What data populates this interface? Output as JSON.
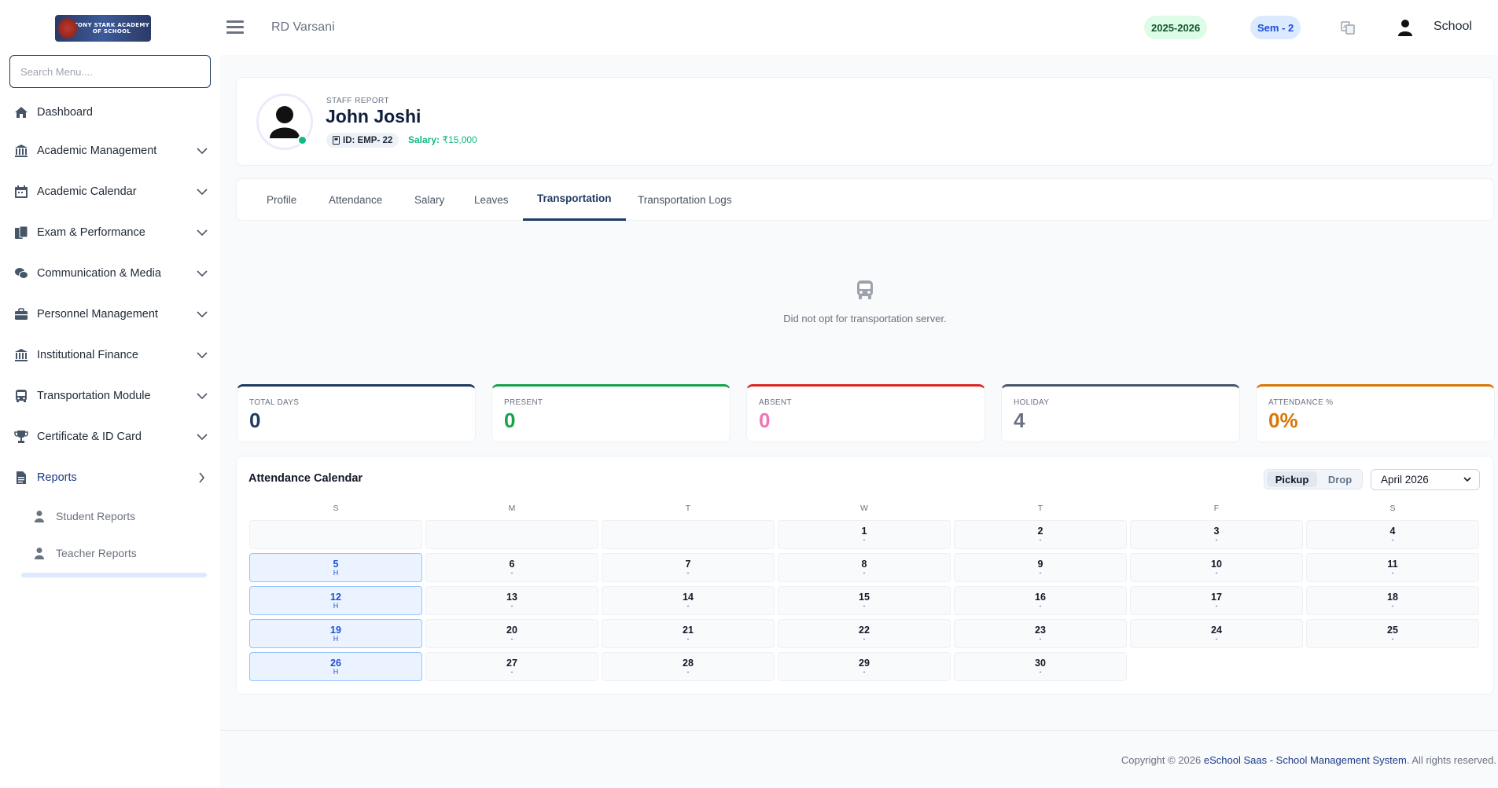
{
  "sidebar": {
    "logo_text": "TONY STARK ACADEMY OF SCHOOL",
    "search_placeholder": "Search Menu....",
    "items": [
      {
        "label": "Dashboard",
        "icon": "home-icon",
        "expandable": false
      },
      {
        "label": "Academic Management",
        "icon": "institution-icon",
        "expandable": true
      },
      {
        "label": "Academic Calendar",
        "icon": "calendar-icon",
        "expandable": true
      },
      {
        "label": "Exam & Performance",
        "icon": "file-copy-icon",
        "expandable": true
      },
      {
        "label": "Communication & Media",
        "icon": "chat-bubbles-icon",
        "expandable": true
      },
      {
        "label": "Personnel Management",
        "icon": "briefcase-icon",
        "expandable": true
      },
      {
        "label": "Institutional Finance",
        "icon": "bank-icon",
        "expandable": true
      },
      {
        "label": "Transportation Module",
        "icon": "bus-icon",
        "expandable": true
      },
      {
        "label": "Certificate & ID Card",
        "icon": "trophy-icon",
        "expandable": true
      },
      {
        "label": "Reports",
        "icon": "report-file-icon",
        "expandable": true,
        "active": true
      }
    ],
    "subitems": [
      {
        "label": "Student Reports",
        "icon": "user-icon"
      },
      {
        "label": "Teacher Reports",
        "icon": "user-icon"
      }
    ]
  },
  "header": {
    "school_name": "RD Varsani",
    "year": "2025-2026",
    "semester": "Sem - 2",
    "user_name": "School"
  },
  "profile": {
    "section_label": "STAFF REPORT",
    "name": "John Joshi",
    "id_text": "ID: EMP- 22",
    "salary_label": "Salary:",
    "salary_value": "₹15,000"
  },
  "tabs": [
    "Profile",
    "Attendance",
    "Salary",
    "Leaves",
    "Transportation",
    "Transportation Logs"
  ],
  "active_tab": "Transportation",
  "empty_state": {
    "message": "Did not opt for transportation server."
  },
  "stats": [
    {
      "label": "TOTAL DAYS",
      "value": "0",
      "color": "#1e3a5f"
    },
    {
      "label": "PRESENT",
      "value": "0",
      "color": "#16a34a"
    },
    {
      "label": "ABSENT",
      "value": "0",
      "color": "#dc2626"
    },
    {
      "label": "HOLIDAY",
      "value": "4",
      "color": "#475569"
    },
    {
      "label": "ATTENDANCE %",
      "value": "0%",
      "color": "#d97706"
    }
  ],
  "calendar": {
    "title": "Attendance Calendar",
    "toggle": {
      "pickup": "Pickup",
      "drop": "Drop",
      "active": "Pickup"
    },
    "month": "April 2026",
    "weekdays": [
      "S",
      "M",
      "T",
      "W",
      "T",
      "F",
      "S"
    ],
    "first_weekday": 3,
    "days": [
      {
        "n": "1",
        "s": "-"
      },
      {
        "n": "2",
        "s": "-"
      },
      {
        "n": "3",
        "s": "-"
      },
      {
        "n": "4",
        "s": "-"
      },
      {
        "n": "5",
        "s": "H",
        "holiday": true
      },
      {
        "n": "6",
        "s": "-"
      },
      {
        "n": "7",
        "s": "-"
      },
      {
        "n": "8",
        "s": "-"
      },
      {
        "n": "9",
        "s": "-"
      },
      {
        "n": "10",
        "s": "-"
      },
      {
        "n": "11",
        "s": "-"
      },
      {
        "n": "12",
        "s": "H",
        "holiday": true
      },
      {
        "n": "13",
        "s": "-"
      },
      {
        "n": "14",
        "s": "-"
      },
      {
        "n": "15",
        "s": "-"
      },
      {
        "n": "16",
        "s": "-"
      },
      {
        "n": "17",
        "s": "-"
      },
      {
        "n": "18",
        "s": "-"
      },
      {
        "n": "19",
        "s": "H",
        "holiday": true
      },
      {
        "n": "20",
        "s": "-"
      },
      {
        "n": "21",
        "s": "-"
      },
      {
        "n": "22",
        "s": "-"
      },
      {
        "n": "23",
        "s": "-"
      },
      {
        "n": "24",
        "s": "-"
      },
      {
        "n": "25",
        "s": "-"
      },
      {
        "n": "26",
        "s": "H",
        "holiday": true
      },
      {
        "n": "27",
        "s": "-"
      },
      {
        "n": "28",
        "s": "-"
      },
      {
        "n": "29",
        "s": "-"
      },
      {
        "n": "30",
        "s": "-"
      }
    ]
  },
  "footer": {
    "prefix": "Copyright © 2026 ",
    "link": "eSchool Saas - School Management System",
    "suffix": ". All rights reserved."
  }
}
